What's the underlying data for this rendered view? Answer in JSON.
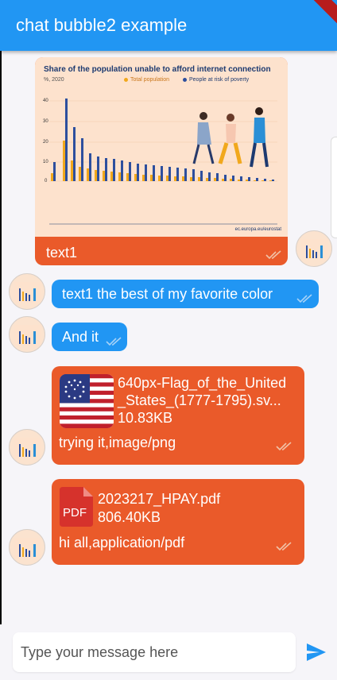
{
  "app": {
    "title": "chat bubble2 example"
  },
  "image_message": {
    "caption": "text1",
    "image": {
      "title": "Share of the population unable to afford internet connection",
      "subtitle": "%, 2020",
      "legend": [
        "Total population",
        "People at risk of poverty"
      ],
      "y_ticks": [
        "40",
        "30",
        "20",
        "10",
        "0"
      ],
      "source": "ec.europa.eu/eurostat"
    }
  },
  "messages": [
    {
      "text": "text1 the best of my favorite color"
    },
    {
      "text": "And it"
    }
  ],
  "file_messages": [
    {
      "file_name": "640px-Flag_of_the_United_States_(1777-1795).sv...",
      "file_name_line1": "640px-Flag_of_the_United",
      "file_name_line2": "_States_(1777-1795).sv...",
      "size": "10.83KB",
      "caption": "trying it,image/png"
    },
    {
      "file_name": "2023217_HPAY.pdf",
      "size": "806.40KB",
      "icon_label": "PDF",
      "caption": "hi all,application/pdf"
    }
  ],
  "composer": {
    "placeholder": "Type your message here"
  },
  "colors": {
    "app_bar": "#2196f3",
    "sent_bubble": "#2196f3",
    "file_bubble": "#ea5a2a",
    "background": "#f6f5f9"
  }
}
